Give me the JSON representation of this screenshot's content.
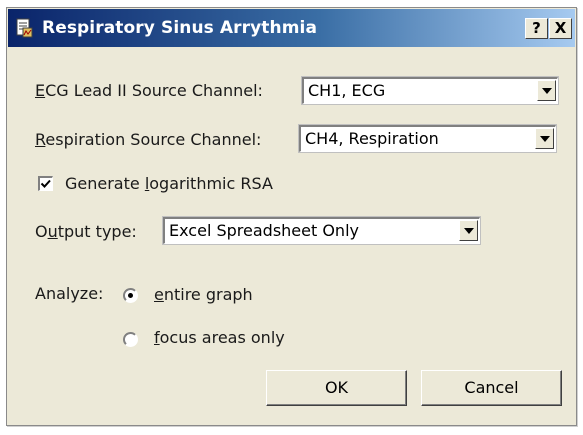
{
  "window": {
    "title": "Respiratory Sinus Arrythmia",
    "help_label": "?",
    "close_label": "X"
  },
  "ecg": {
    "label_accel": "E",
    "label_rest": "CG Lead II Source Channel:",
    "value": "CH1, ECG"
  },
  "respiration": {
    "label_accel": "R",
    "label_rest": "espiration Source Channel:",
    "value": "CH4, Respiration"
  },
  "logarithmic": {
    "label_pre": "Generate ",
    "label_accel": "l",
    "label_post": "ogarithmic RSA",
    "checked": true
  },
  "output": {
    "label_pre": "O",
    "label_accel": "u",
    "label_post": "tput type:",
    "value": "Excel Spreadsheet Only"
  },
  "analyze": {
    "label": "Analyze:",
    "option1_accel": "e",
    "option1_rest": "ntire graph",
    "option2_accel": "f",
    "option2_rest": "ocus areas only",
    "selected": "entire graph"
  },
  "buttons": {
    "ok": "OK",
    "cancel": "Cancel"
  },
  "icons": {
    "app": "document-chart-icon",
    "combo_arrow": "chevron-down-icon",
    "check": "checkmark-icon"
  }
}
